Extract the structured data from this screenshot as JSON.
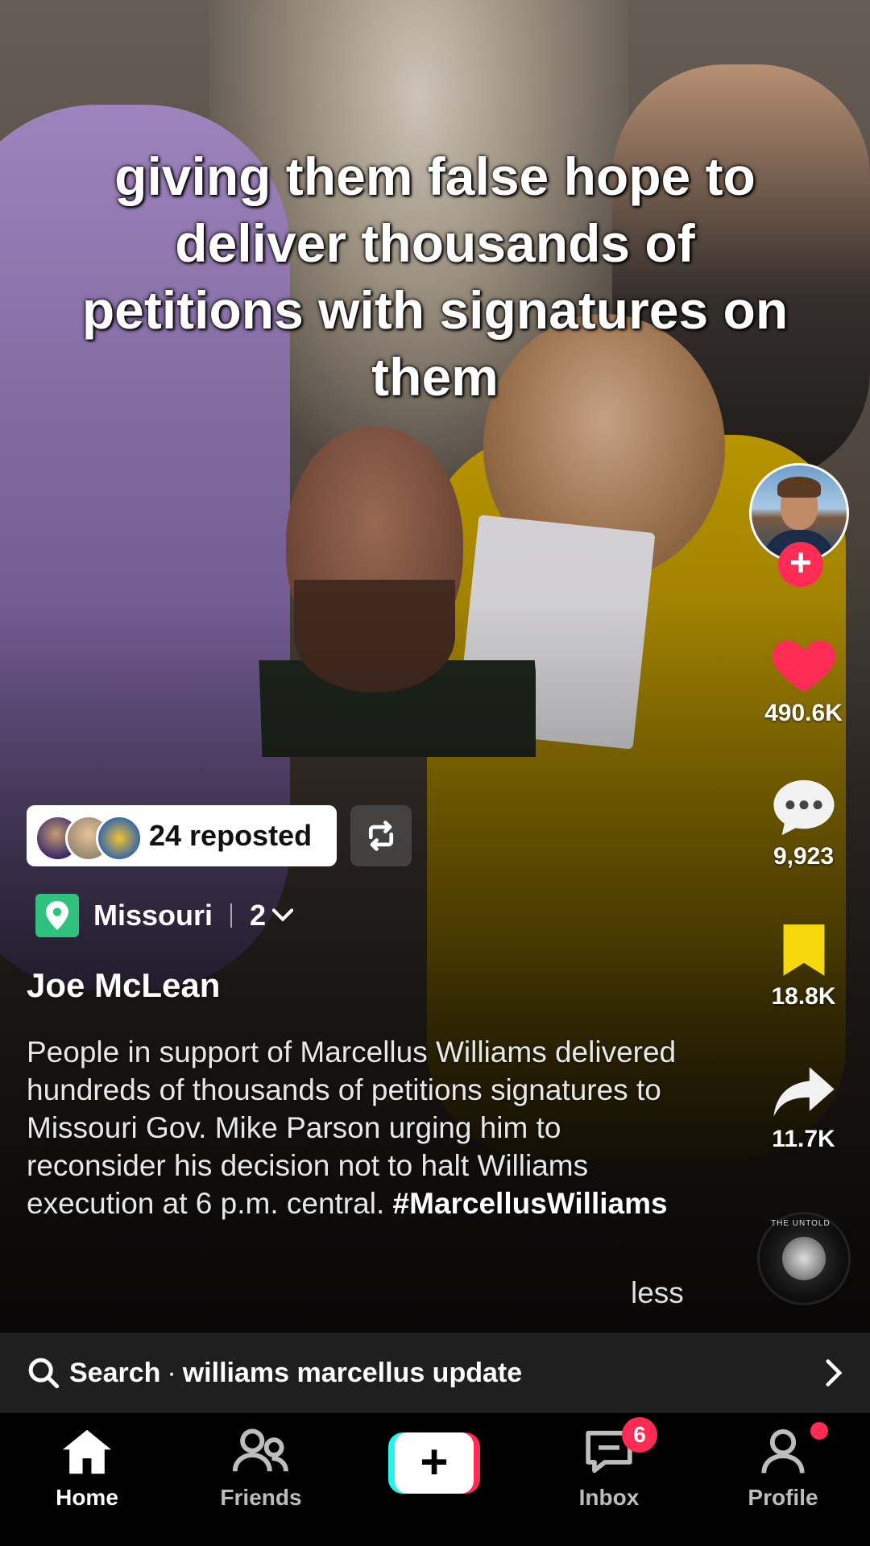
{
  "caption": "giving them false hope to deliver thousands of petitions with signatures on them",
  "creator_avatar_icon": "creator-avatar",
  "actions": {
    "likes": "490.6K",
    "comments": "9,923",
    "saves": "18.8K",
    "shares": "11.7K"
  },
  "music": {
    "disc_text": "THE UNTOLD"
  },
  "reposted": {
    "label": "24 reposted"
  },
  "location": {
    "name": "Missouri",
    "count": "2"
  },
  "author": "Joe McLean",
  "description": {
    "text": "People in support of Marcellus Williams delivered hundreds of thousands of petitions signatures to Missouri Gov. Mike Parson urging him to reconsider his decision not to halt Williams execution at 6 p.m. central.",
    "hashtag": "#MarcellusWilliams",
    "less": "less"
  },
  "search": {
    "prefix": "Search",
    "query": "williams marcellus update"
  },
  "tabs": [
    {
      "label": "Home",
      "icon": "home-icon"
    },
    {
      "label": "Friends",
      "icon": "friends-icon"
    },
    {
      "label": "",
      "icon": "create-icon"
    },
    {
      "label": "Inbox",
      "icon": "inbox-icon"
    },
    {
      "label": "Profile",
      "icon": "profile-icon"
    }
  ],
  "inbox_badge": "6",
  "colors": {
    "accent": "#fe2c55",
    "cyan": "#25f4ee",
    "location": "#2ec27e",
    "bookmark": "#f5d90a"
  }
}
